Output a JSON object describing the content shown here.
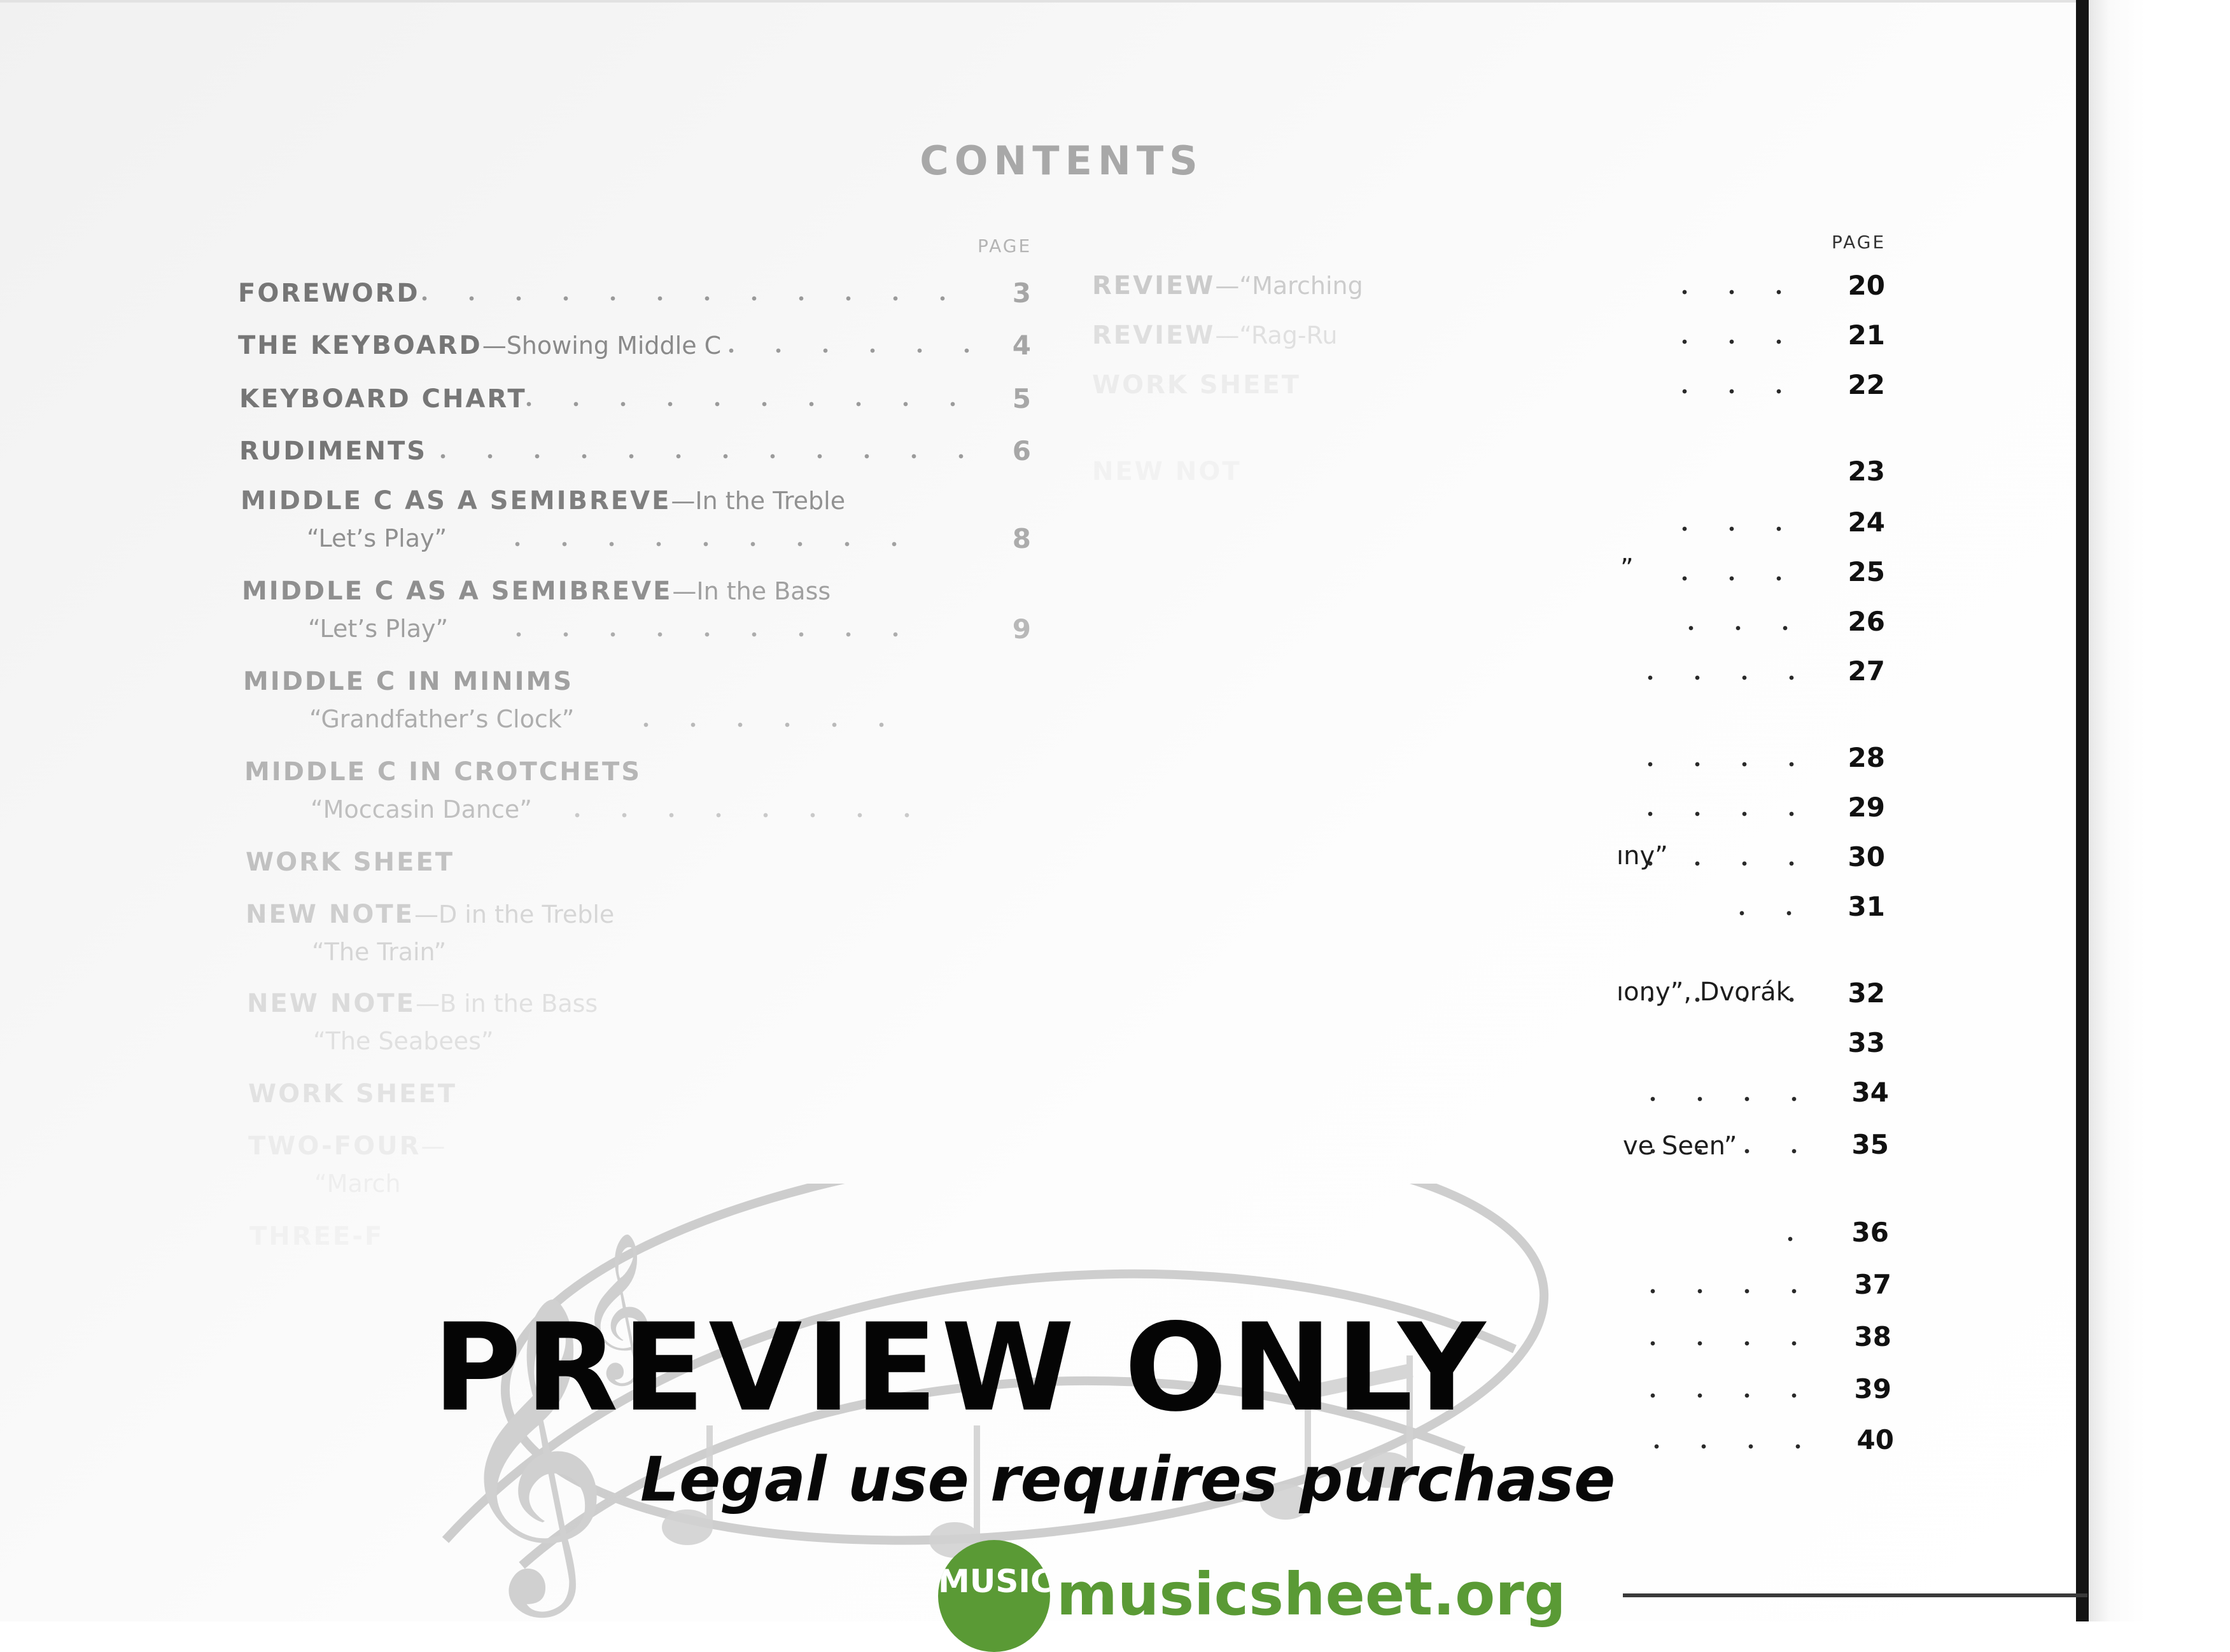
{
  "title": "CONTENTS",
  "page_header_left": "PAGE",
  "page_header_right": "PAGE",
  "left_entries": [
    {
      "strong": "FOREWORD",
      "sub": "",
      "subtitle": "",
      "page": "3"
    },
    {
      "strong": "THE KEYBOARD",
      "sub": "—Showing Middle C",
      "subtitle": "",
      "page": "4"
    },
    {
      "strong": "KEYBOARD CHART",
      "sub": "",
      "subtitle": "",
      "page": "5"
    },
    {
      "strong": "RUDIMENTS",
      "sub": "",
      "subtitle": "",
      "page": "6"
    },
    {
      "strong": "MIDDLE C AS A SEMIBREVE",
      "sub": "—In the Treble",
      "subtitle": "“Let’s Play”",
      "page": "8"
    },
    {
      "strong": "MIDDLE C AS A SEMIBREVE",
      "sub": "—In the Bass",
      "subtitle": "“Let’s Play”",
      "page": "9"
    },
    {
      "strong": "MIDDLE C IN MINIMS",
      "sub": "",
      "subtitle": "“Grandfather’s Clock”",
      "page": ""
    },
    {
      "strong": "MIDDLE C IN CROTCHETS",
      "sub": "",
      "subtitle": "“Moccasin Dance”",
      "page": ""
    },
    {
      "strong": "WORK SHEET",
      "sub": "",
      "subtitle": "",
      "page": ""
    },
    {
      "strong": "NEW NOTE",
      "sub": "—D in the Treble",
      "subtitle": "“The Train”",
      "page": ""
    },
    {
      "strong": "NEW NOTE",
      "sub": "—B in the Bass",
      "subtitle": "“The Seabees”",
      "page": ""
    },
    {
      "strong": "WORK SHEET",
      "sub": "",
      "subtitle": "",
      "page": ""
    },
    {
      "strong": "TWO-FOUR",
      "sub": "—",
      "subtitle": "“March",
      "page": ""
    },
    {
      "strong": "THREE-F",
      "sub": "",
      "subtitle": "",
      "page": ""
    },
    {
      "strong": "",
      "sub": "",
      "subtitle": "",
      "page": ""
    }
  ],
  "right_entries": [
    {
      "strong": "REVIEW",
      "sub": "—“Marching",
      "page": "20"
    },
    {
      "strong": "REVIEW",
      "sub": "—“Rag-Ru",
      "page": "21"
    },
    {
      "strong": "WORK SHEET",
      "sub": "",
      "page": "22"
    },
    {
      "strong": "NEW NOT",
      "sub": "",
      "page": "23"
    },
    {
      "strong": "",
      "sub": "",
      "page": "24"
    },
    {
      "strong": "",
      "sub": "",
      "page": "25"
    },
    {
      "strong": "",
      "sub": "",
      "page": "26"
    },
    {
      "strong": "",
      "sub": "",
      "page": "27"
    },
    {
      "strong": "",
      "sub": "",
      "page": "28"
    },
    {
      "strong": "",
      "sub": "",
      "page": "29"
    },
    {
      "strong": "",
      "sub": "",
      "page": "30"
    },
    {
      "strong": "",
      "sub": "",
      "page": "31"
    },
    {
      "strong": "",
      "sub": "",
      "page": "32"
    },
    {
      "strong": "",
      "sub": "",
      "page": "33"
    },
    {
      "strong": "",
      "sub": "",
      "page": "34"
    },
    {
      "strong": "",
      "sub": "",
      "page": "35"
    },
    {
      "strong": "",
      "sub": "",
      "page": "36"
    },
    {
      "strong": "",
      "sub": "",
      "page": "37"
    },
    {
      "strong": "",
      "sub": "",
      "page": "38"
    },
    {
      "strong": "",
      "sub": "",
      "page": "39"
    },
    {
      "strong": "",
      "sub": "",
      "page": "40"
    }
  ],
  "right_fragments": {
    "frag_25": "”",
    "frag_30": "ıny”",
    "frag_32": "ıony”, Dvorák",
    "frag_35": "ve Seen”"
  },
  "watermark": {
    "title": "PREVIEW ONLY",
    "subtitle": "Legal use requires purchase",
    "logo_badge": "MUSIC",
    "logo_text": "musicsheet.org",
    "brand_color": "#5a9a35"
  }
}
